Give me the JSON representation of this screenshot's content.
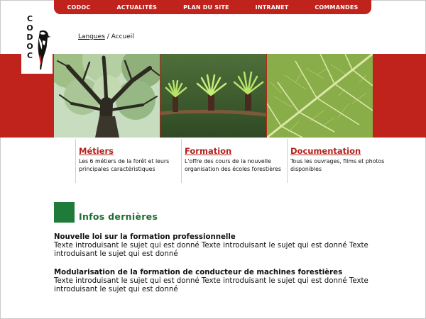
{
  "nav": {
    "items": [
      {
        "label": "CODOC"
      },
      {
        "label": "ACTUALITÉS"
      },
      {
        "label": "PLAN DU SITE"
      },
      {
        "label": "INTRANET"
      },
      {
        "label": "COMMANDES"
      }
    ]
  },
  "logo": {
    "text": "CODOC"
  },
  "breadcrumb": {
    "link": "Langues",
    "separator": " / ",
    "current": "Accueil"
  },
  "photos": [
    {
      "subject": "tree-canopy"
    },
    {
      "subject": "larch-twig-buds"
    },
    {
      "subject": "leaf-veins"
    }
  ],
  "sections": [
    {
      "title": "Métiers",
      "description": "Les 6 métiers de la forêt et leurs principales caractéristiques"
    },
    {
      "title": "Formation",
      "description": "L'offre des cours de la nouvelle organisation des écoles forestières"
    },
    {
      "title": "Documentation",
      "description": "Tous les ouvrages, films et photos disponibles"
    }
  ],
  "infos": {
    "heading": "Infos dernières",
    "articles": [
      {
        "title": "Nouvelle loi sur la formation professionnelle",
        "body": "Texte introduisant le sujet qui est donné Texte introduisant le sujet qui est donné Texte introduisant le sujet qui est donné"
      },
      {
        "title": "Modularisation de la formation de conducteur de machines forestières",
        "body": "Texte introduisant le sujet qui est donné Texte introduisant le sujet qui est donné Texte introduisant le sujet qui est donné"
      }
    ]
  },
  "colors": {
    "accent": "#c0221c",
    "green": "#1e7b3a",
    "section_title": "#b3211b"
  }
}
